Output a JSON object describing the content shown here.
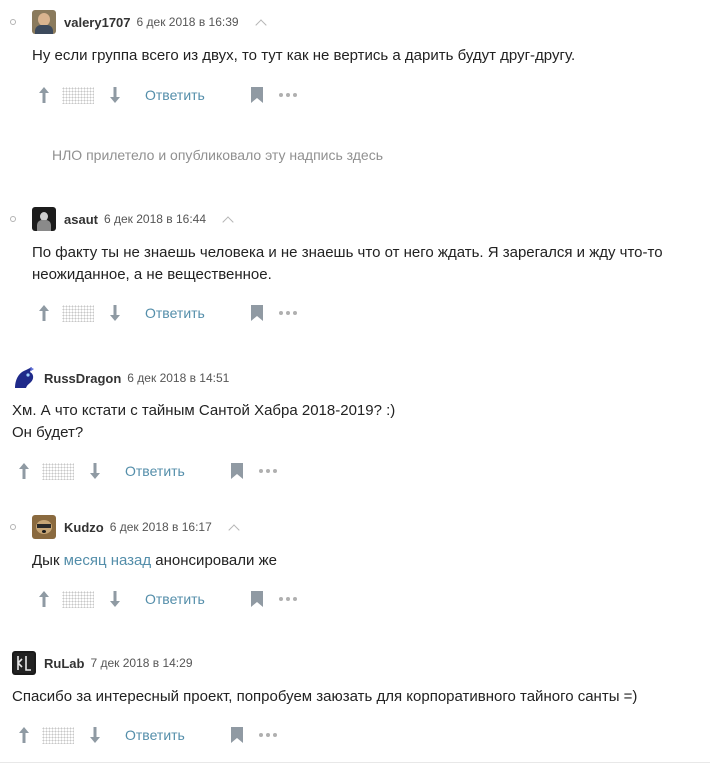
{
  "comments": [
    {
      "username": "valery1707",
      "date": "6 дек 2018 в 16:39",
      "text_lines": [
        "Ну если группа всего из двух, то тут как не вертись а дарить будут друг-другу."
      ],
      "reply_label": "Ответить"
    },
    {
      "username": "asaut",
      "date": "6 дек 2018 в 16:44",
      "text_lines": [
        "По факту ты не знаешь человека и не знаешь что от него ждать. Я зарегался и жду что-то",
        "неожиданное, а не вещественное."
      ],
      "reply_label": "Ответить"
    },
    {
      "username": "RussDragon",
      "date": "6 дек 2018 в 14:51",
      "text_lines": [
        "Хм. А что кстати с тайным Сантой Хабра 2018-2019? :)",
        "Он будет?"
      ],
      "reply_label": "Ответить"
    },
    {
      "username": "Kudzo",
      "date": "6 дек 2018 в 16:17",
      "text_before": "Дык ",
      "link_text": "месяц назад",
      "text_after": " анонсировали же",
      "reply_label": "Ответить"
    },
    {
      "username": "RuLab",
      "date": "7 дек 2018 в 14:29",
      "text_lines": [
        "Спасибо за интересный проект, попробуем заюзать для корпоративного тайного санты =)"
      ],
      "reply_label": "Ответить"
    }
  ],
  "ufo_notice": "НЛО прилетело и опубликовало эту надпись здесь",
  "icons": {
    "vote_up": "arrow-up-icon",
    "vote_down": "arrow-down-icon",
    "bookmark": "bookmark-icon",
    "more": "more-dots-icon",
    "parent": "chevron-up-icon"
  },
  "colors": {
    "link": "#548eaa",
    "muted": "#909090"
  }
}
